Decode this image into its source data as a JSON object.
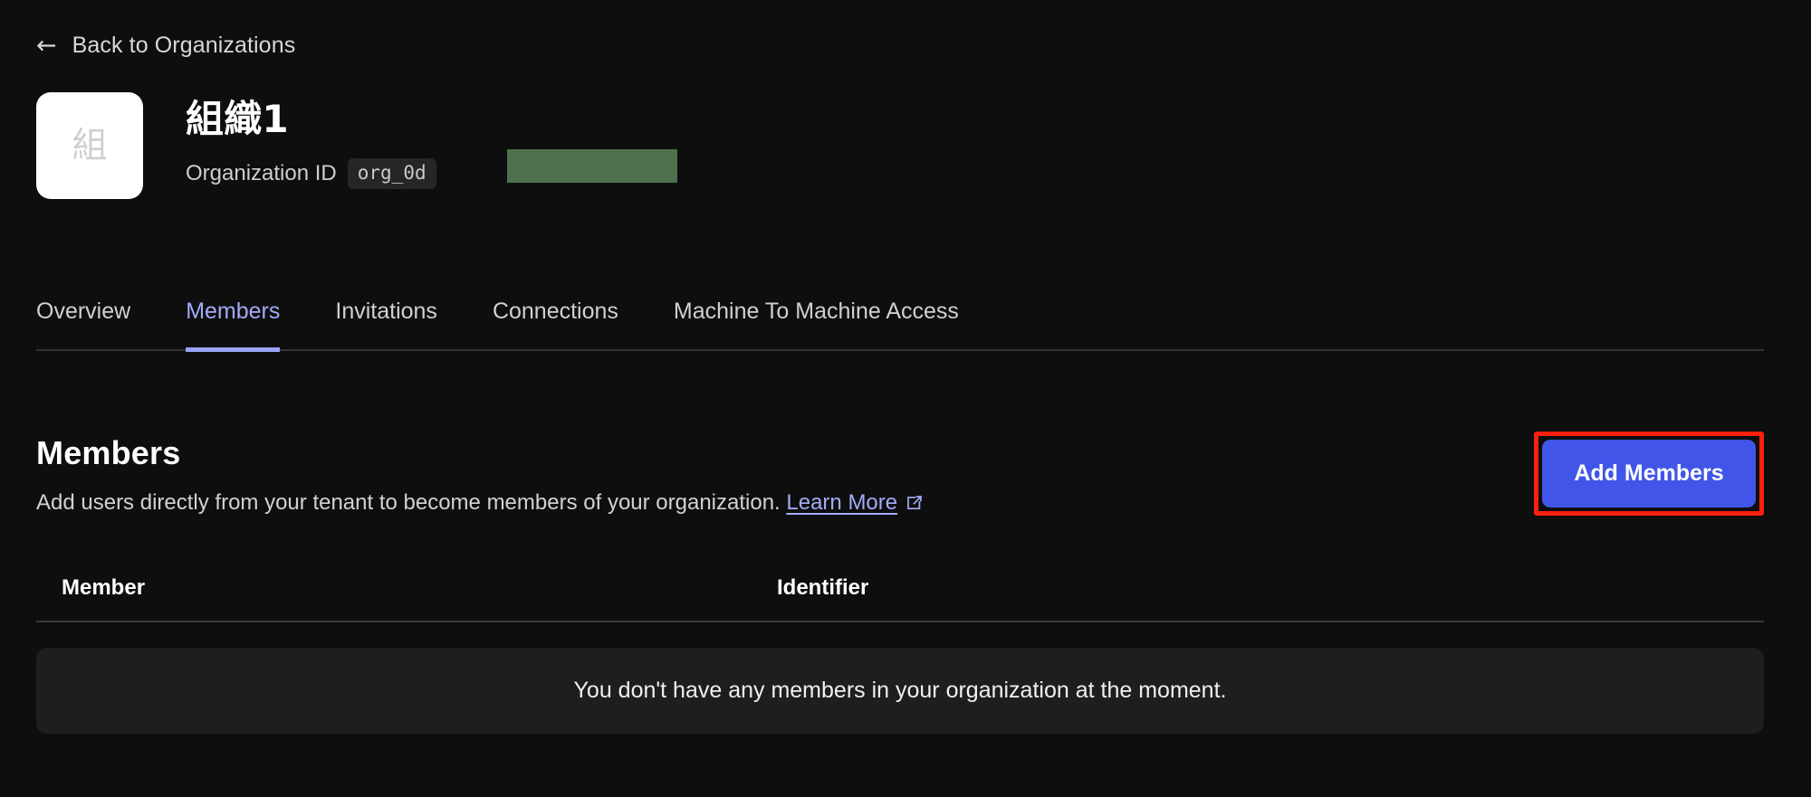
{
  "back_link": {
    "icon": "arrow-left-icon",
    "arrow": "←",
    "label": "Back to Organizations"
  },
  "org_header": {
    "avatar_initial": "組",
    "title": "組織1",
    "id_label": "Organization ID",
    "id_value": "org_0d",
    "redacted": true,
    "redaction_color": "#4d714e"
  },
  "tabs": [
    {
      "label": "Overview",
      "active": false
    },
    {
      "label": "Members",
      "active": true
    },
    {
      "label": "Invitations",
      "active": false
    },
    {
      "label": "Connections",
      "active": false
    },
    {
      "label": "Machine To Machine Access",
      "active": false
    }
  ],
  "section": {
    "title": "Members",
    "description": "Add users directly from your tenant to become members of your organization.",
    "learn_more_label": "Learn More",
    "learn_more_icon": "external-link-icon"
  },
  "actions": {
    "add_members_label": "Add Members",
    "add_members_color": "#4155e8",
    "annotation_color": "#ff1f0f"
  },
  "table": {
    "columns": [
      "Member",
      "Identifier"
    ],
    "rows": [],
    "empty_message": "You don't have any members in your organization at the moment."
  },
  "colors": {
    "background": "#0e0e0e",
    "accent": "#a2abf8",
    "panel": "#1e1e1e",
    "text_primary": "#ffffff",
    "text_secondary": "#d2d2d2"
  }
}
